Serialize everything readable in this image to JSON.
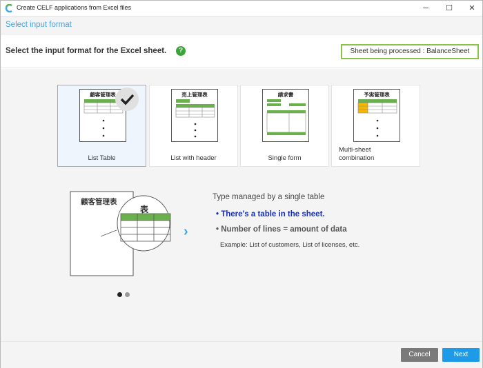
{
  "window": {
    "title": "Create CELF applications from Excel files",
    "controls": {
      "minimize": "─",
      "maximize": "☐",
      "close": "✕"
    }
  },
  "step": {
    "title": "Select input format"
  },
  "instruction": {
    "text": "Select the input format for the Excel sheet.",
    "help": "?",
    "sheet_badge": "Sheet being processed : BalanceSheet"
  },
  "formats": [
    {
      "label": "List Table",
      "thumb_title": "顧客管理表",
      "selected": true
    },
    {
      "label": "List with header",
      "thumb_title": "売上管理表",
      "selected": false
    },
    {
      "label": "Single form",
      "thumb_title": "請求書",
      "selected": false
    },
    {
      "label": "Multi-sheet combination",
      "label_line1": "Multi-sheet",
      "label_line2": "combination",
      "thumb_title": "予実管理表",
      "selected": false
    }
  ],
  "illustration": {
    "doc_title": "顧客管理表",
    "zoom_title": "表"
  },
  "description": {
    "title": "Type managed by a single table",
    "bullet1": "There's a table in the sheet.",
    "bullet2": "Number of lines = amount of data",
    "example": "Example: List of customers, List of licenses, etc."
  },
  "pager": {
    "current": 1,
    "total": 2
  },
  "footer": {
    "cancel_label": "Cancel",
    "next_label": "Next"
  },
  "colors": {
    "accent": "#3aa7e8",
    "green": "#6ab04c",
    "next_button": "#1e9be8",
    "cancel_button": "#7a7a7a",
    "bullet_highlight": "#1a2fb8",
    "badge_border": "#8bc34a",
    "orange_cell": "#f5b800"
  }
}
